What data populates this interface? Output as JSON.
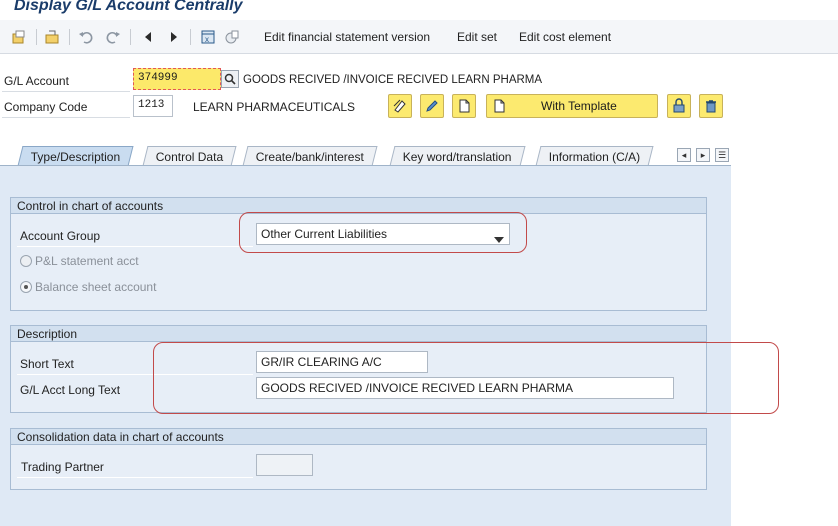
{
  "window": {
    "title": "Display G/L Account Centrally"
  },
  "toolbar": {
    "edit_fsv_label": "Edit financial statement version",
    "edit_set_label": "Edit set",
    "edit_cost_element_label": "Edit cost element"
  },
  "header": {
    "gl_account_label": "G/L Account",
    "gl_account_value": "374999",
    "gl_account_description": "GOODS RECIVED /INVOICE RECIVED LEARN PHARMA",
    "company_code_label": "Company Code",
    "company_code_value": "1213",
    "company_name": "LEARN PHARMACEUTICALS",
    "with_template_label": "With Template"
  },
  "tabs": [
    {
      "label": "Type/Description",
      "active": true
    },
    {
      "label": "Control Data"
    },
    {
      "label": "Create/bank/interest"
    },
    {
      "label": "Key word/translation"
    },
    {
      "label": "Information (C/A)"
    }
  ],
  "control_group": {
    "title": "Control in chart of accounts",
    "account_group_label": "Account Group",
    "account_group_value": "Other Current Liabilities",
    "pl_label": "P&L statement acct",
    "bs_label": "Balance sheet account",
    "selected": "Balance sheet account"
  },
  "description_group": {
    "title": "Description",
    "short_text_label": "Short Text",
    "short_text_value": "GR/IR CLEARING A/C",
    "long_text_label": "G/L Acct Long Text",
    "long_text_value": "GOODS RECIVED /INVOICE RECIVED LEARN PHARMA"
  },
  "consolidation_group": {
    "title": "Consolidation data in chart of accounts",
    "trading_partner_label": "Trading Partner",
    "trading_partner_value": ""
  },
  "colors": {
    "title": "#1a3c6a",
    "panel": "#dfe9f5",
    "highlight_input": "#fce96a",
    "annotation": "#c24a4a"
  }
}
